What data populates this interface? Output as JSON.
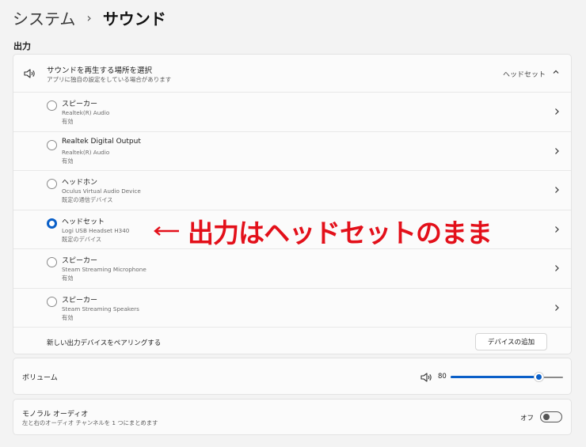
{
  "breadcrumb": {
    "parent": "システム",
    "separator": "›",
    "current": "サウンド"
  },
  "section": {
    "title": "出力"
  },
  "output": {
    "title": "サウンドを再生する場所を選択",
    "subtitle": "アプリに独自の設定をしている場合があります",
    "selected_value": "ヘッドセット",
    "devices": [
      {
        "name": "スピーカー",
        "detail": "Realtek(R) Audio",
        "status": "有効",
        "selected": false
      },
      {
        "name": "Realtek Digital Output",
        "detail": "Realtek(R) Audio",
        "status": "有効",
        "selected": false
      },
      {
        "name": "ヘッドホン",
        "detail": "Oculus Virtual Audio Device",
        "status": "既定の通信デバイス",
        "selected": false
      },
      {
        "name": "ヘッドセット",
        "detail": "Logi USB Headset H340",
        "status": "既定のデバイス",
        "selected": true
      },
      {
        "name": "スピーカー",
        "detail": "Steam Streaming Microphone",
        "status": "有効",
        "selected": false
      },
      {
        "name": "スピーカー",
        "detail": "Steam Streaming Speakers",
        "status": "有効",
        "selected": false
      }
    ],
    "pair_label": "新しい出力デバイスをペアリングする",
    "add_button": "デバイスの追加"
  },
  "annotation": {
    "text": "出力はヘッドセットのまま",
    "color": "#e3101a"
  },
  "volume": {
    "label": "ボリューム",
    "value": "80",
    "level": 0.78
  },
  "mono": {
    "title": "モノラル オーディオ",
    "subtitle": "左と右のオーディオ チャンネルを 1 つにまとめます",
    "toggle_label": "オフ",
    "enabled": false
  },
  "colors": {
    "accent": "#0a5fc8",
    "background": "#f3f3f3",
    "card": "#fbfbfb"
  }
}
